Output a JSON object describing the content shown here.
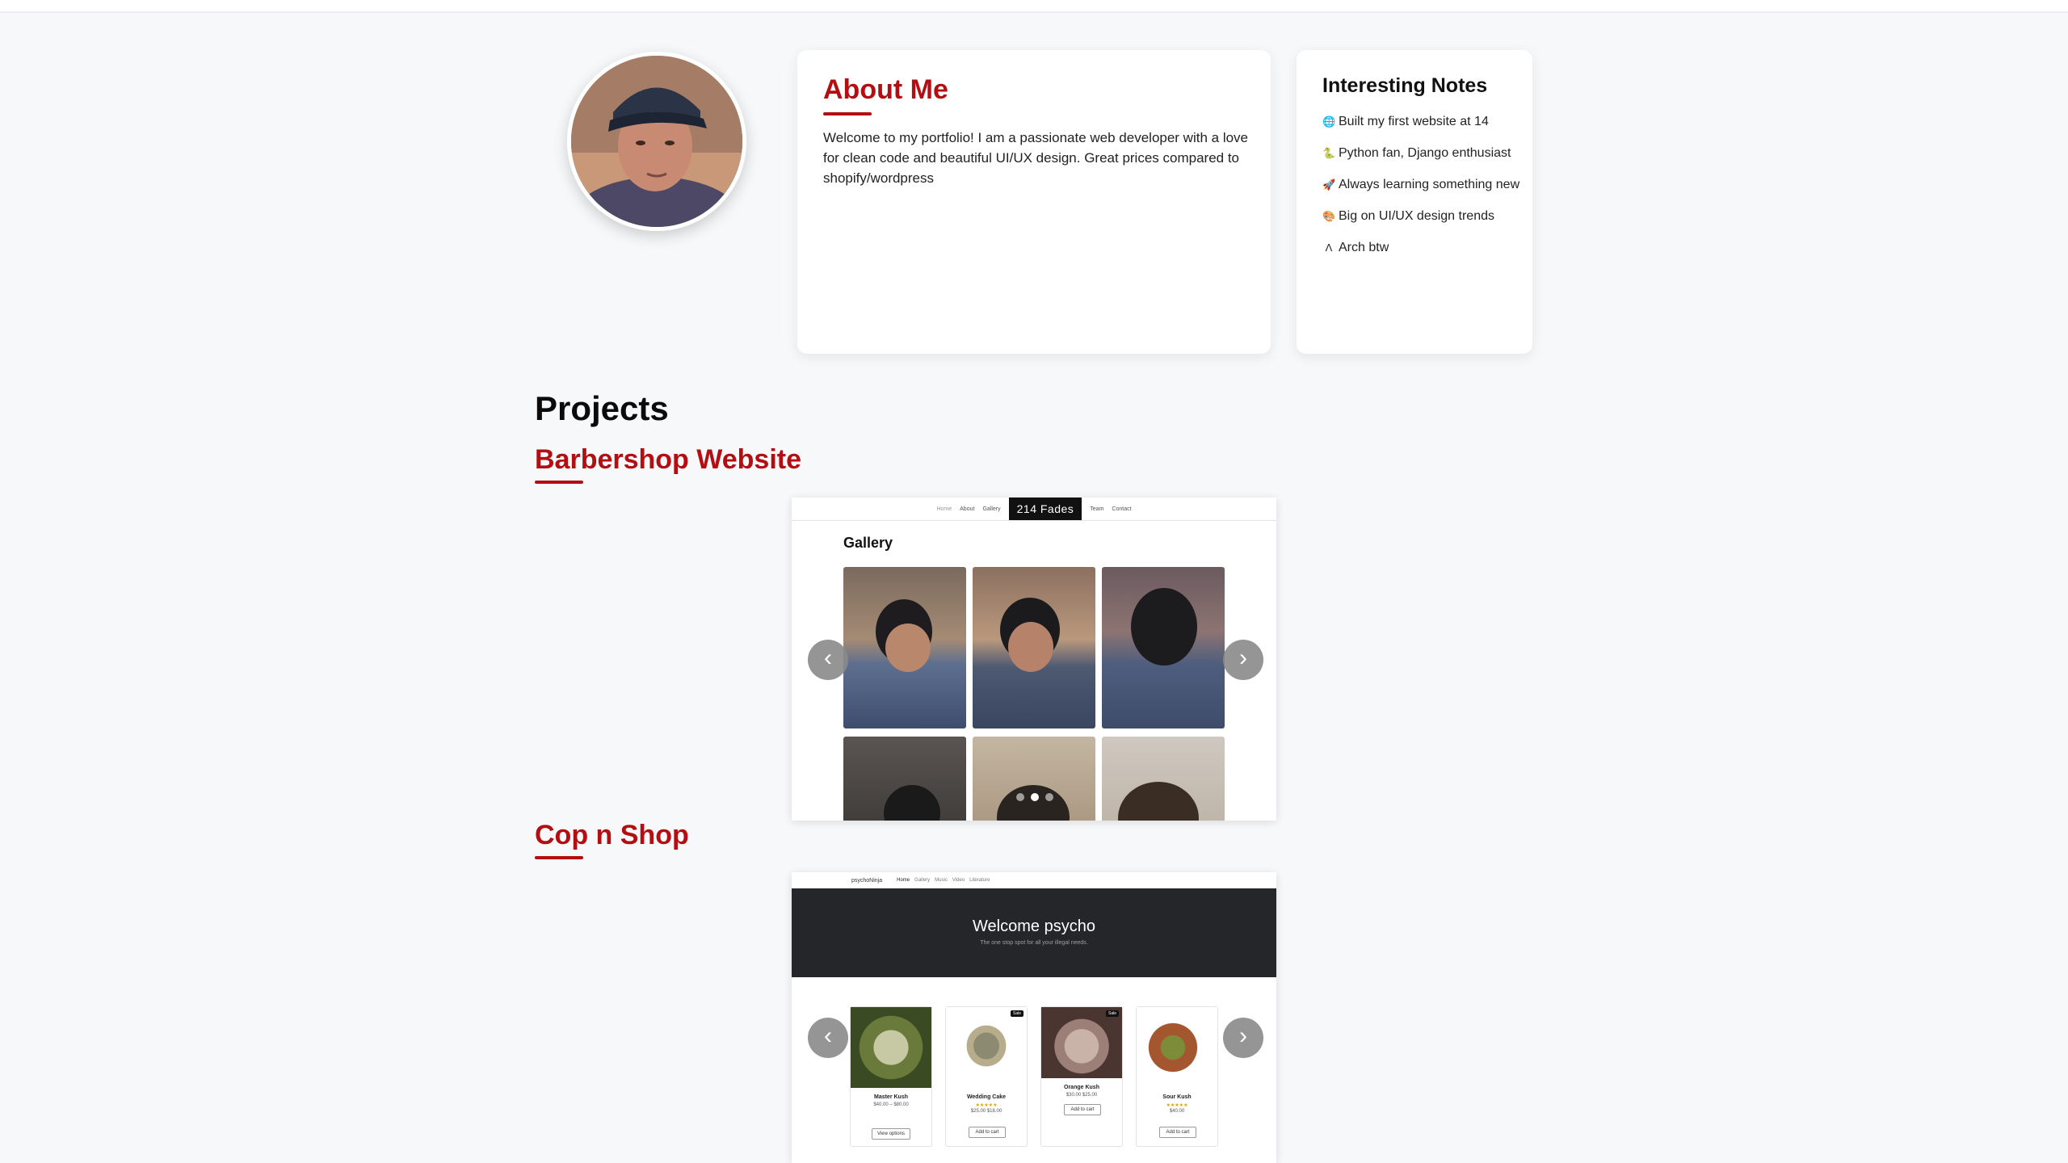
{
  "about": {
    "title": "About Me",
    "text": "Welcome to my portfolio! I am a passionate web developer with a love for clean code and beautiful UI/UX design. Great prices compared to shopify/wordpress"
  },
  "notes": {
    "title": "Interesting Notes",
    "items": [
      {
        "icon": "🌐",
        "text": "Built my first website at 14"
      },
      {
        "icon": "🐍",
        "text": "Python fan, Django enthusiast"
      },
      {
        "icon": "🚀",
        "text": "Always learning something new"
      },
      {
        "icon": "🎨",
        "text": "Big on UI/UX design trends"
      },
      {
        "icon": "Λ",
        "text": "Arch btw"
      }
    ]
  },
  "projects": {
    "heading": "Projects",
    "items": [
      {
        "title": "Barbershop Website",
        "preview": {
          "nav_left": [
            "Home",
            "About",
            "Gallery"
          ],
          "brand": "214 Fades",
          "nav_right": [
            "Team",
            "Contact"
          ],
          "section_title": "Gallery",
          "prev": "‹",
          "next": "›"
        }
      },
      {
        "title": "Cop n Shop",
        "preview": {
          "brand": "psychoNinja",
          "nav": [
            "Home",
            "Gallery",
            "Music",
            "Video",
            "Literature"
          ],
          "hero_title": "Welcome psycho",
          "hero_sub": "The one stop spot for all your illegal needs.",
          "prev": "‹",
          "next": "›",
          "products": [
            {
              "name": "Master Kush",
              "price": "$40.00 – $80.00",
              "button": "View options",
              "sale": ""
            },
            {
              "name": "Wedding Cake",
              "stars": "★★★★★",
              "price": "$25.00 $18.00",
              "button": "Add to cart",
              "sale": "Sale"
            },
            {
              "name": "Orange Kush",
              "price": "$30.00 $25.00",
              "button": "Add to cart",
              "sale": "Sale"
            },
            {
              "name": "Sour Kush",
              "stars": "★★★★★",
              "price": "$40.00",
              "button": "Add to cart",
              "sale": ""
            }
          ]
        }
      }
    ]
  },
  "colors": {
    "accent": "#b30f12",
    "hero_bg": "#24262a"
  }
}
